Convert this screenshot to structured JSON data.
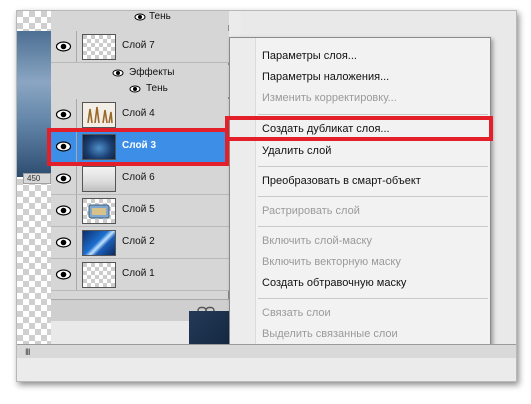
{
  "layers_panel": {
    "top_partial_label": "Тень",
    "layers": [
      {
        "name": "Слой 7",
        "thumb": "transparent",
        "selected": false
      },
      {
        "name": "Слой 4",
        "thumb": "figures",
        "selected": false
      },
      {
        "name": "Слой 3",
        "thumb": "dark-blue",
        "selected": true
      },
      {
        "name": "Слой 6",
        "thumb": "transparent-light",
        "selected": false
      },
      {
        "name": "Слой 5",
        "thumb": "blue-object",
        "selected": false
      },
      {
        "name": "Слой 2",
        "thumb": "blue-flare",
        "selected": false
      },
      {
        "name": "Слой 1",
        "thumb": "transparent",
        "selected": false
      }
    ],
    "effects_label": "Эффекты",
    "shadow_label": "Тень"
  },
  "ruler_value": "450",
  "context_menu": {
    "items": [
      {
        "label": "Параметры слоя...",
        "enabled": true
      },
      {
        "label": "Параметры наложения...",
        "enabled": true
      },
      {
        "label": "Изменить корректировку...",
        "enabled": false
      },
      {
        "label": "Создать дубликат слоя...",
        "enabled": true
      },
      {
        "label": "Удалить слой",
        "enabled": true
      },
      {
        "label": "Преобразовать в смарт-объект",
        "enabled": true
      },
      {
        "label": "Растрировать слой",
        "enabled": false
      },
      {
        "label": "Включить слой-маску",
        "enabled": false
      },
      {
        "label": "Включить векторную маску",
        "enabled": false
      },
      {
        "label": "Создать обтравочную маску",
        "enabled": true
      },
      {
        "label": "Связать слои",
        "enabled": false
      },
      {
        "label": "Выделить связанные слои",
        "enabled": false
      }
    ]
  },
  "colors": {
    "highlight": "#e3202a",
    "selection": "#3d8ee6"
  },
  "bottom_bar": {
    "grip": "III"
  }
}
